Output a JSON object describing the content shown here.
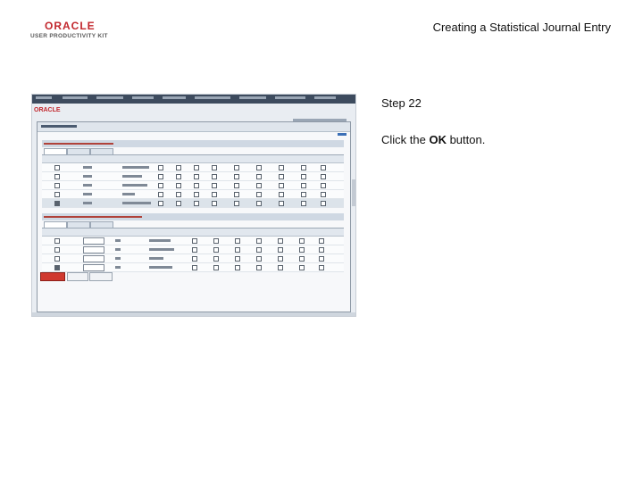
{
  "logo": {
    "word": "ORACLE",
    "sub": "USER PRODUCTIVITY KIT"
  },
  "page": {
    "heading": "Creating a Statistical Journal Entry",
    "step": "Step 22",
    "instruction_prefix": "Click the ",
    "instruction_bold": "OK",
    "instruction_suffix": " button."
  },
  "colors": {
    "oracle_red": "#c2272d",
    "ok_button": "#d0392f",
    "nav_bar": "#3d4b5e"
  }
}
